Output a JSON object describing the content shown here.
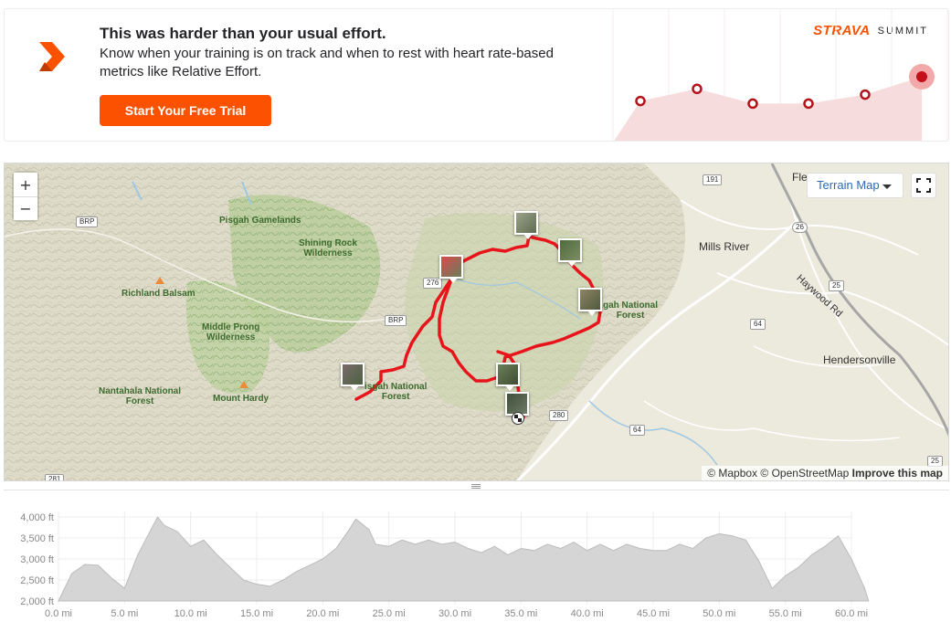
{
  "promo": {
    "title": "This was harder than your usual effort.",
    "body": "Know when your training is on track and when to rest with heart rate-based metrics like Relative Effort.",
    "cta": "Start Your Free Trial",
    "brand": "STRAVA",
    "brand_product": "SUMMIT",
    "accent": "#fc5200",
    "effort_points": [
      0.62,
      0.81,
      0.58,
      0.58,
      0.72,
      1.0
    ]
  },
  "map": {
    "zoom_in": "+",
    "zoom_out": "−",
    "layer_button": "Terrain Map",
    "attribution": {
      "mapbox": "© Mapbox",
      "osm": "© OpenStreetMap",
      "improve": "Improve this map"
    },
    "labels": {
      "pisgah_gamelands": "Pisgah Gamelands",
      "shining_rock": "Shining Rock\nWilderness",
      "richland_balsam": "Richland Balsam",
      "middle_prong": "Middle Prong\nWilderness",
      "nantahala": "Nantahala National\nForest",
      "mount_hardy": "Mount Hardy",
      "pisgah_nf_south": "isgah National\nForest",
      "pisgah_nf_east": "gah National\nForest",
      "mills_river": "Mills River",
      "haywood_rd": "Haywood Rd",
      "hendersonville": "Hendersonville",
      "fletcher": "Fle"
    },
    "shields": {
      "brp_west": "BRP",
      "brp_center": "BRP",
      "us276": "276",
      "us191": "191",
      "i26": "26",
      "us25": "25",
      "us64_north": "64",
      "us64_south": "64",
      "nc280": "280",
      "nc281": "281",
      "i25_south": "25"
    },
    "route_color": "#e8141b"
  },
  "elevation": {
    "y_ticks": [
      "4,000 ft",
      "3,500 ft",
      "3,000 ft",
      "2,500 ft",
      "2,000 ft"
    ],
    "x_ticks": [
      "0.0 mi",
      "5.0 mi",
      "10.0 mi",
      "15.0 mi",
      "20.0 mi",
      "25.0 mi",
      "30.0 mi",
      "35.0 mi",
      "40.0 mi",
      "45.0 mi",
      "50.0 mi",
      "55.0 mi",
      "60.0 mi"
    ],
    "profile_ft": [
      [
        0,
        2000
      ],
      [
        1,
        2650
      ],
      [
        2,
        2870
      ],
      [
        3,
        2850
      ],
      [
        4,
        2550
      ],
      [
        5,
        2300
      ],
      [
        6,
        3100
      ],
      [
        7,
        3700
      ],
      [
        7.5,
        4000
      ],
      [
        8,
        3800
      ],
      [
        9,
        3650
      ],
      [
        10,
        3300
      ],
      [
        11,
        3450
      ],
      [
        12,
        3100
      ],
      [
        13,
        2800
      ],
      [
        14,
        2500
      ],
      [
        15,
        2400
      ],
      [
        16,
        2350
      ],
      [
        17,
        2500
      ],
      [
        18,
        2700
      ],
      [
        19,
        2850
      ],
      [
        20,
        3000
      ],
      [
        21,
        3250
      ],
      [
        22,
        3700
      ],
      [
        22.5,
        3950
      ],
      [
        23.5,
        3700
      ],
      [
        24,
        3350
      ],
      [
        25,
        3300
      ],
      [
        26,
        3450
      ],
      [
        27,
        3350
      ],
      [
        28,
        3450
      ],
      [
        29,
        3350
      ],
      [
        30,
        3400
      ],
      [
        31,
        3250
      ],
      [
        32,
        3150
      ],
      [
        33,
        3300
      ],
      [
        34,
        3100
      ],
      [
        35,
        3250
      ],
      [
        36,
        3200
      ],
      [
        37,
        3350
      ],
      [
        38,
        3250
      ],
      [
        39,
        3400
      ],
      [
        40,
        3200
      ],
      [
        41,
        3350
      ],
      [
        42,
        3200
      ],
      [
        43,
        3350
      ],
      [
        44,
        3250
      ],
      [
        45,
        3200
      ],
      [
        46,
        3200
      ],
      [
        47,
        3350
      ],
      [
        48,
        3250
      ],
      [
        49,
        3500
      ],
      [
        50,
        3600
      ],
      [
        51,
        3550
      ],
      [
        52,
        3450
      ],
      [
        53,
        2950
      ],
      [
        54,
        2300
      ],
      [
        55,
        2600
      ],
      [
        56,
        2800
      ],
      [
        57,
        3100
      ],
      [
        58,
        3300
      ],
      [
        59,
        3550
      ],
      [
        60,
        3000
      ],
      [
        61,
        2300
      ],
      [
        61.3,
        2000
      ]
    ]
  }
}
